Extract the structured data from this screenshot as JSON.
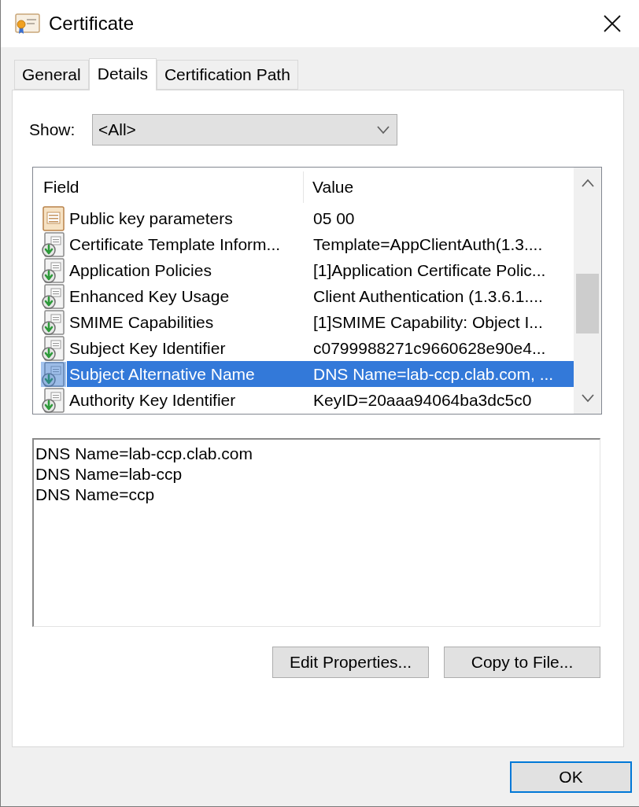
{
  "window": {
    "title": "Certificate"
  },
  "tabs": [
    {
      "label": "General",
      "selected": false
    },
    {
      "label": "Details",
      "selected": true
    },
    {
      "label": "Certification Path",
      "selected": false
    }
  ],
  "show": {
    "label": "Show:",
    "value": "<All>"
  },
  "fields_table": {
    "columns": [
      "Field",
      "Value"
    ],
    "rows": [
      {
        "kind": "property",
        "field": "Public key parameters",
        "value": "05 00",
        "selected": false
      },
      {
        "kind": "extension",
        "field": "Certificate Template Inform...",
        "value": "Template=AppClientAuth(1.3....",
        "selected": false
      },
      {
        "kind": "extension",
        "field": "Application Policies",
        "value": "[1]Application Certificate Polic...",
        "selected": false
      },
      {
        "kind": "extension",
        "field": "Enhanced Key Usage",
        "value": "Client Authentication (1.3.6.1....",
        "selected": false
      },
      {
        "kind": "extension",
        "field": "SMIME Capabilities",
        "value": "[1]SMIME Capability: Object I...",
        "selected": false
      },
      {
        "kind": "extension",
        "field": "Subject Key Identifier",
        "value": "c0799988271c9660628e90e4...",
        "selected": false
      },
      {
        "kind": "extension",
        "field": "Subject Alternative Name",
        "value": "DNS Name=lab-ccp.clab.com, ...",
        "selected": true
      },
      {
        "kind": "extension",
        "field": "Authority Key Identifier",
        "value": "KeyID=20aaa94064ba3dc5c0",
        "selected": false
      }
    ]
  },
  "detail_text": [
    "DNS Name=lab-ccp.clab.com",
    "DNS Name=lab-ccp",
    "DNS Name=ccp"
  ],
  "buttons": [
    "Edit Properties...",
    "Copy to File..."
  ],
  "footer_buttons": [
    {
      "label": "OK",
      "default": true
    }
  ]
}
